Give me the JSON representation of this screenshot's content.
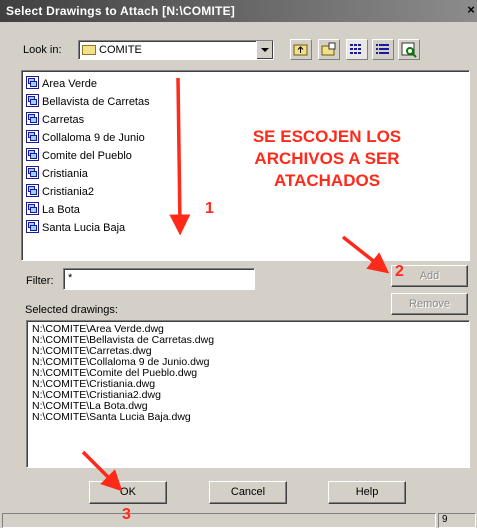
{
  "window": {
    "title": "Select Drawings to Attach [N:\\COMITE]",
    "close": "×"
  },
  "look_in": {
    "label": "Look in:",
    "value": "COMITE"
  },
  "files": [
    "Area Verde",
    "Bellavista de Carretas",
    "Carretas",
    "Collaloma 9 de Junio",
    "Comite del Pueblo",
    "Cristiania",
    "Cristiania2",
    "La Bota",
    "Santa Lucia Baja"
  ],
  "filter": {
    "label": "Filter:",
    "value": "*"
  },
  "buttons": {
    "add": "Add",
    "remove": "Remove",
    "ok": "OK",
    "cancel": "Cancel",
    "help": "Help"
  },
  "selected": {
    "label": "Selected drawings:",
    "items": [
      "N:\\COMITE\\Area Verde.dwg",
      "N:\\COMITE\\Bellavista de Carretas.dwg",
      "N:\\COMITE\\Carretas.dwg",
      "N:\\COMITE\\Collaloma 9 de Junio.dwg",
      "N:\\COMITE\\Comite del Pueblo.dwg",
      "N:\\COMITE\\Cristiania.dwg",
      "N:\\COMITE\\Cristiania2.dwg",
      "N:\\COMITE\\La Bota.dwg",
      "N:\\COMITE\\Santa Lucia Baja.dwg"
    ]
  },
  "annotations": {
    "note": "SE ESCOJEN LOS ARCHIVOS A SER ATACHADOS",
    "step1": "1",
    "step2": "2",
    "step3": "3"
  },
  "status": {
    "value": "9"
  },
  "colors": {
    "annotation": "#ff2a1a",
    "title_bar": "#404040"
  }
}
